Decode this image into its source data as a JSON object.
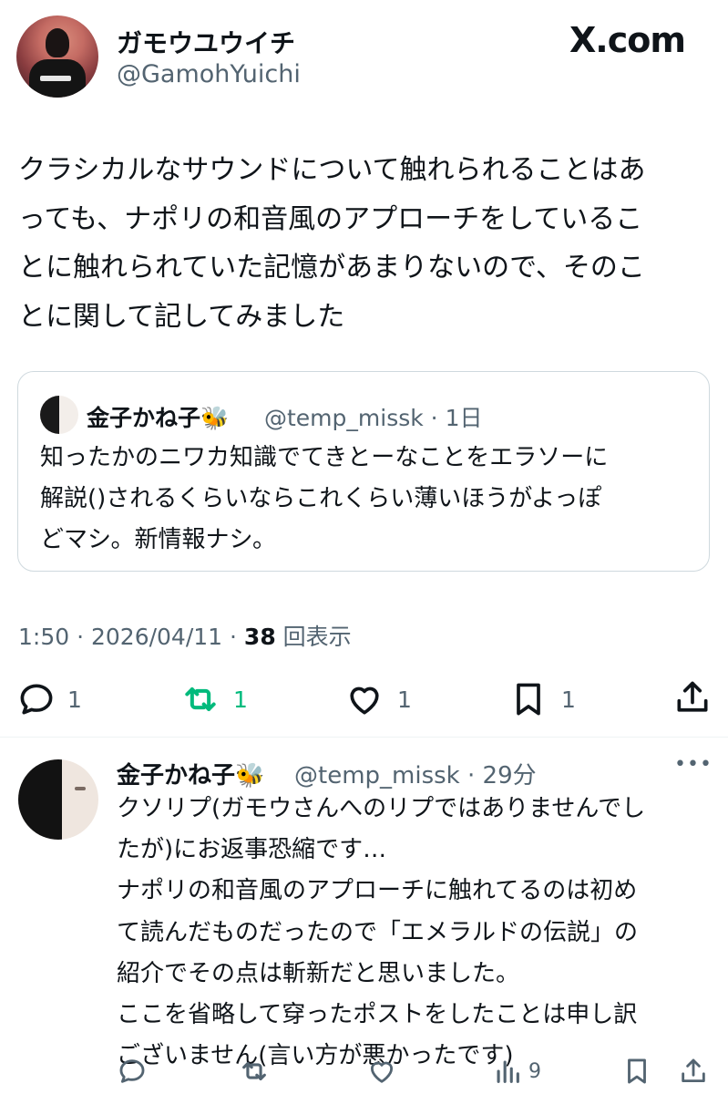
{
  "header": {
    "author_name": "ガモウユウイチ",
    "author_handle": "@GamohYuichi",
    "watermark": "X.com"
  },
  "tweet": {
    "text": "クラシカルなサウンドについて触れられることはあ\nっても、ナポリの和音風のアプローチをしているこ\nとに触れられていた記憶があまりないので、そのこ\nとに関して記してみました"
  },
  "quote": {
    "author_name": "金子かね子🐝",
    "author_handle": "@temp_missk",
    "time": "1日",
    "text": "知ったかのニワカ知識でてきとーなことをエラソーに\n解説()されるくらいならこれくらい薄いほうがよっぽ\nどマシ。新情報ナシ。"
  },
  "meta": {
    "time": "1:50",
    "date": "2026/04/11",
    "views_count": "38",
    "views_label": "回表示"
  },
  "actions": {
    "reply_count": "1",
    "repost_count": "1",
    "like_count": "1",
    "bookmark_count": "1"
  },
  "reply": {
    "author_name": "金子かね子🐝",
    "author_handle": "@temp_missk",
    "time": "29分",
    "text": "クソリプ(ガモウさんへのリプではありませんでし\nたが)にお返事恐縮です…\nナポリの和音風のアプローチに触れてるのは初め\nて読んだものだったので「エメラルドの伝説」の\n紹介でその点は斬新だと思いました。\nここを省略して穿ったポストをしたことは申し訳\nございません(言い方が悪かったです)",
    "views_count": "9"
  },
  "colors": {
    "text": "#0f1419",
    "secondary": "#536471",
    "repost_active": "#00ba7c",
    "border": "#cfd9de"
  },
  "icons": [
    "reply-icon",
    "repost-icon",
    "like-icon",
    "bookmark-icon",
    "share-icon",
    "views-icon",
    "more-icon"
  ]
}
